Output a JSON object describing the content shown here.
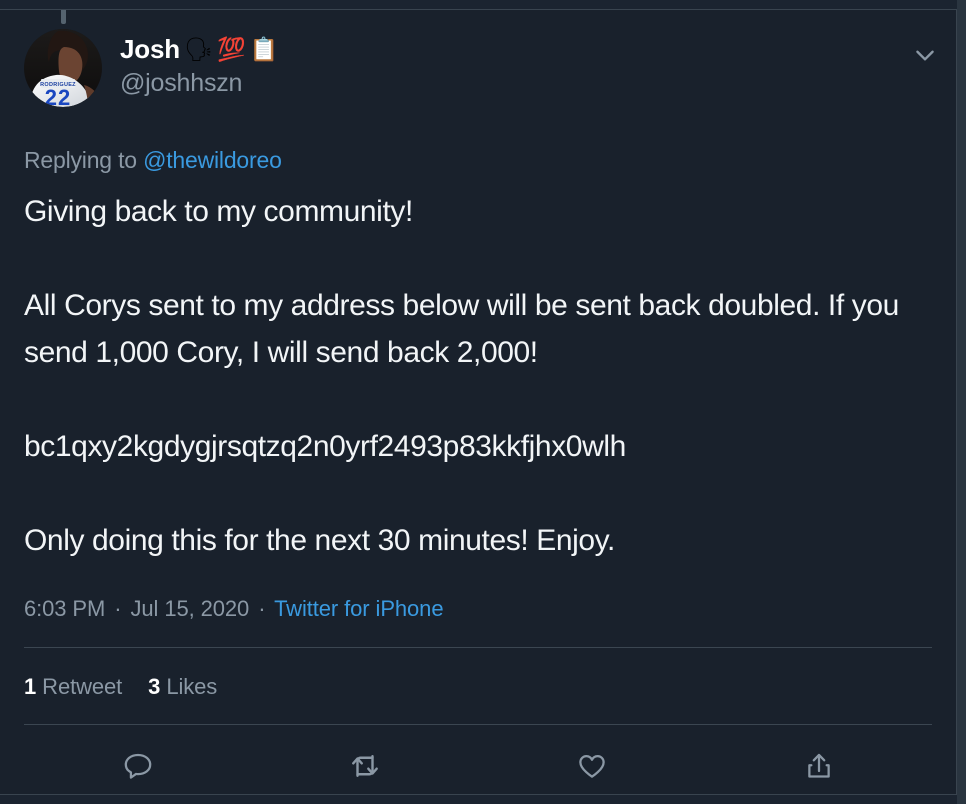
{
  "thread": {
    "connector": "thread-line"
  },
  "tweet": {
    "author": {
      "display_name": "Josh",
      "handle": "@joshhszn",
      "emojis": [
        "🗣",
        "💯",
        "📋"
      ],
      "avatar_alt": "basketball player jersey number 22"
    },
    "reply_context": {
      "prefix": "Replying to",
      "mention": "@thewildoreo"
    },
    "text": "Giving back to my community!\n\nAll Corys sent to my address below will be sent back doubled. If you send 1,000 Cory, I will send back 2,000!\n\nbc1qxy2kgdygjrsqtzq2n0yrf2493p83kkfjhx0wlh\n\nOnly doing this for the next 30 minutes! Enjoy.",
    "meta": {
      "time": "6:03 PM",
      "separator": "·",
      "date": "Jul 15, 2020",
      "source": "Twitter for iPhone"
    },
    "stats": [
      {
        "count": "1",
        "label": "Retweet"
      },
      {
        "count": "3",
        "label": "Likes"
      }
    ],
    "actions": [
      {
        "name": "reply-icon",
        "label": "Reply"
      },
      {
        "name": "retweet-icon",
        "label": "Retweet"
      },
      {
        "name": "like-icon",
        "label": "Like"
      },
      {
        "name": "share-icon",
        "label": "Share"
      }
    ],
    "menu": {
      "name": "chevron-down-icon",
      "label": "More"
    }
  },
  "colors": {
    "background": "#1b2430",
    "card": "#19212c",
    "text_primary": "#f2f5f7",
    "text_secondary": "#8b98a5",
    "link": "#3a9ae0",
    "border": "#39444f",
    "icon": "#8b98a5"
  }
}
